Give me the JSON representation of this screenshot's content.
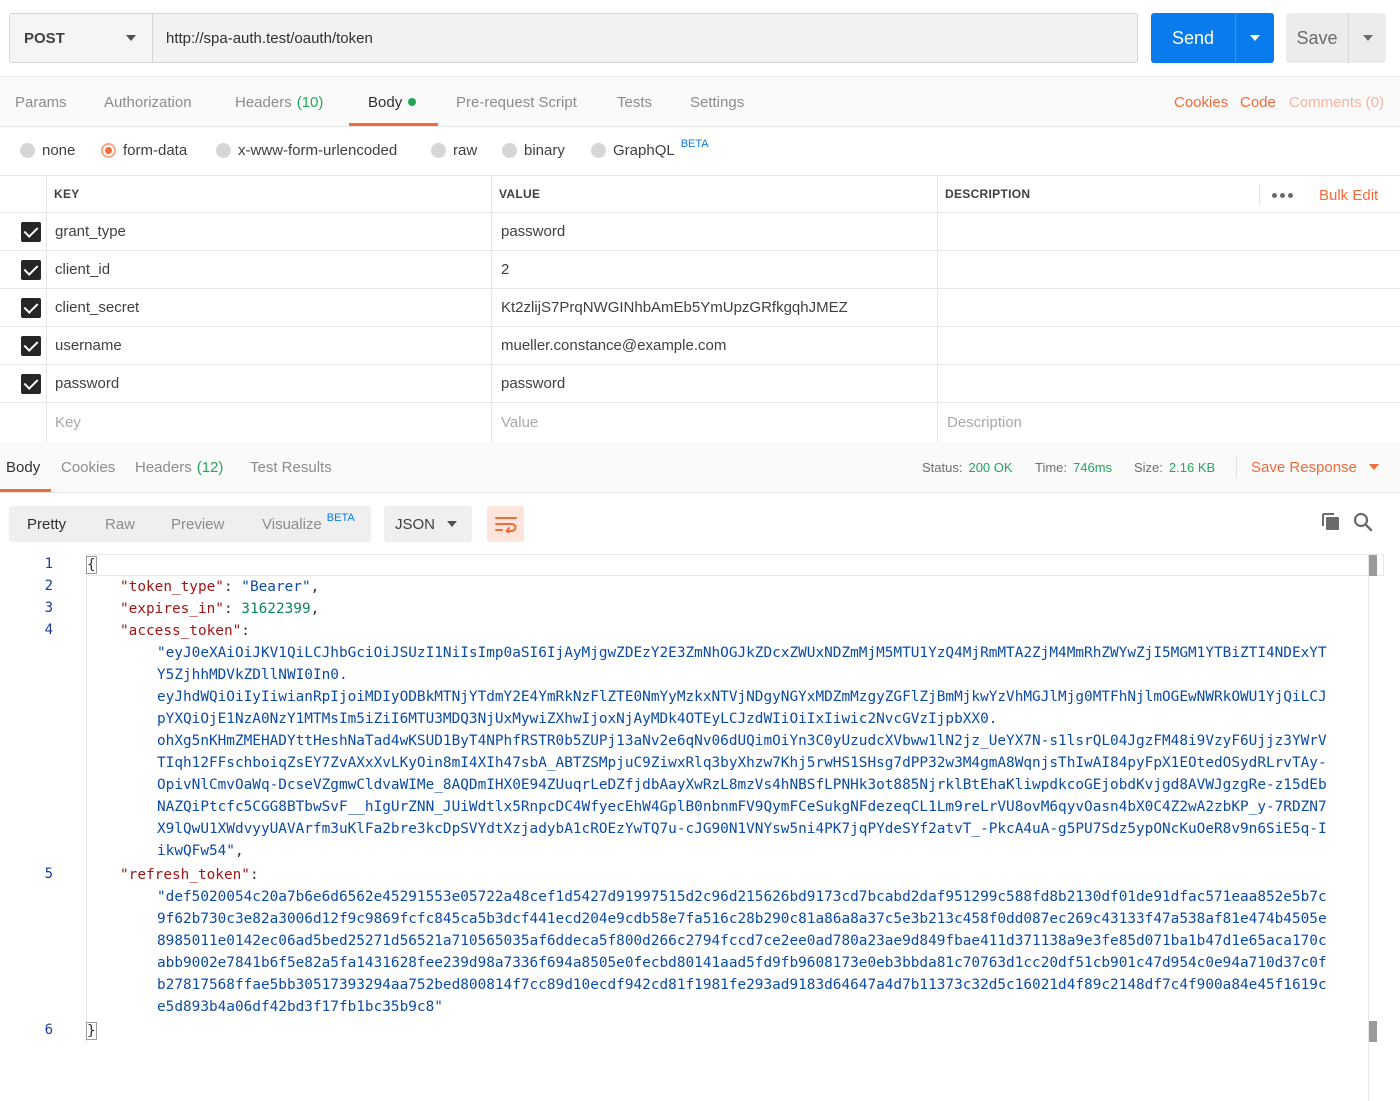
{
  "request": {
    "method": "POST",
    "url": "http://spa-auth.test/oauth/token",
    "send_label": "Send",
    "save_label": "Save"
  },
  "request_tabs": {
    "params": "Params",
    "authorization": "Authorization",
    "headers": "Headers",
    "headers_count": "(10)",
    "body": "Body",
    "pre_request": "Pre-request Script",
    "tests": "Tests",
    "settings": "Settings",
    "cookies": "Cookies",
    "code": "Code",
    "comments": "Comments (0)"
  },
  "body_types": {
    "none": "none",
    "form_data": "form-data",
    "urlencoded": "x-www-form-urlencoded",
    "raw": "raw",
    "binary": "binary",
    "graphql": "GraphQL",
    "beta": "BETA"
  },
  "params_table": {
    "headers": {
      "key": "KEY",
      "value": "VALUE",
      "description": "DESCRIPTION"
    },
    "bulk_edit": "Bulk Edit",
    "rows": [
      {
        "key": "grant_type",
        "value": "password"
      },
      {
        "key": "client_id",
        "value": "2"
      },
      {
        "key": "client_secret",
        "value": "Kt2zlijS7PrqNWGINhbAmEb5YmUpzGRfkgqhJMEZ"
      },
      {
        "key": "username",
        "value": "mueller.constance@example.com"
      },
      {
        "key": "password",
        "value": "password"
      }
    ],
    "placeholders": {
      "key": "Key",
      "value": "Value",
      "description": "Description"
    }
  },
  "response_tabs": {
    "body": "Body",
    "cookies": "Cookies",
    "headers": "Headers",
    "headers_count": "(12)",
    "test_results": "Test Results",
    "status_label": "Status:",
    "status_value": "200 OK",
    "time_label": "Time:",
    "time_value": "746ms",
    "size_label": "Size:",
    "size_value": "2.16 KB",
    "save_response": "Save Response"
  },
  "view": {
    "pretty": "Pretty",
    "raw": "Raw",
    "preview": "Preview",
    "visualize": "Visualize",
    "beta": "BETA",
    "format": "JSON"
  },
  "json_body": {
    "line_numbers": [
      "1",
      "2",
      "3",
      "4",
      "5",
      "6"
    ],
    "open_brace": "{",
    "close_brace": "}",
    "token_type_key": "\"token_type\"",
    "token_type_value": "\"Bearer\"",
    "expires_in_key": "\"expires_in\"",
    "expires_in_value": "31622399",
    "access_token_key": "\"access_token\"",
    "access_token_lines": [
      "\"eyJ0eXAiOiJKV1QiLCJhbGciOiJSUzI1NiIsImp0aSI6IjAyMjgwZDEzY2E3ZmNhOGJkZDcxZWUxNDZmMjM5MTU1YzQ4MjRmMTA2ZjM4MmRhZWYwZjI5MGM1YTBiZTI4NDExYT",
      "Y5ZjhhMDVkZDllNWI0In0.",
      "eyJhdWQiOiIyIiwianRpIjoiMDIyODBkMTNjYTdmY2E4YmRkNzFlZTE0NmYyMzkxNTVjNDgyNGYxMDZmMzgyZGFlZjBmMjkwYzVhMGJlMjg0MTFhNjlmOGEwNWRkOWU1YjQiLCJ",
      "pYXQiOjE1NzA0NzY1MTMsIm5iZiI6MTU3MDQ3NjUxMywiZXhwIjoxNjAyMDk4OTEyLCJzdWIiOiIxIiwic2NvcGVzIjpbXX0.",
      "ohXg5nKHmZMEHADYttHeshNaTad4wKSUD1ByT4NPhfRSTR0b5ZUPj13aNv2e6qNv06dUQimOiYn3C0yUzudcXVbww1lN2jz_UeYX7N-s1lsrQL04JgzFM48i9VzyF6Ujjz3YWrV",
      "TIqh12FFschboiqZsEY7ZvAXxXvLKyOin8mI4XIh47sbA_ABTZSMpjuC9ZiwxRlq3byXhzw7Khj5rwHS1SHsg7dPP32w3M4gmA8WqnjsThIwAI84pyFpX1EOtedOSydRLrvTAy-",
      "OpivNlCmvOaWq-DcseVZgmwCldvaWIMe_8AQDmIHX0E94ZUuqrLeDZfjdbAayXwRzL8mzVs4hNBSfLPNHk3ot885NjrklBtEhaKliwpdkcoGEjobdKvjgd8AVWJgzgRe-z15dEb",
      "NAZQiPtcfc5CGG8BTbwSvF__hIgUrZNN_JUiWdtlx5RnpcDC4WfyecEhW4GplB0nbnmFV9QymFCeSukgNFdezeqCL1Lm9reLrVU8ovM6qyvOasn4bX0C4Z2wA2zbKP_y-7RDZN7",
      "X9lQwU1XWdvyyUAVArfm3uKlFa2bre3kcDpSVYdtXzjadybA1cROEzYwTQ7u-cJG90N1VNYsw5ni4PK7jqPYdeSYf2atvT_-PkcA4uA-g5PU7Sdz5ypONcKuOeR8v9n6SiE5q-I",
      "ikwQFw54\""
    ],
    "refresh_token_key": "\"refresh_token\"",
    "refresh_token_lines": [
      "\"def5020054c20a7b6e6d6562e45291553e05722a48cef1d5427d91997515d2c96d215626bd9173cd7bcabd2daf951299c588fd8b2130df01de91dfac571eaa852e5b7c",
      "9f62b730c3e82a3006d12f9c9869fcfc845ca5b3dcf441ecd204e9cdb58e7fa516c28b290c81a86a8a37c5e3b213c458f0dd087ec269c43133f47a538af81e474b4505e",
      "8985011e0142ec06ad5bed25271d56521a710565035af6ddeca5f800d266c2794fccd7ce2ee0ad780a23ae9d849fbae411d371138a9e3fe85d071ba1b47d1e65aca170c",
      "abb9002e7841b6f5e82a5fa1431628fee239d98a7336f694a8505e0fecbd80141aad5fd9fb9608173e0eb3bbda81c70763d1cc20df51cb901c47d954c0e94a710d37c0f",
      "b27817568ffae5bb30517393294aa752bed800814f7cc89d10ecdf942cd81f1981fe293ad9183d64647a4d7b11373c32d5c16021d4f89c2148df7c4f900a84e45f1619c",
      "e5d893b4a06df42bd3f17fb1bc35b9c8\""
    ]
  },
  "icons": {
    "copy": "copy-icon",
    "search": "search-icon",
    "wrap": "wrap-lines-icon",
    "more": "more-horizontal-icon"
  },
  "colors": {
    "send_blue": "#097bed",
    "accent_orange": "#f26b3a",
    "status_green": "#26a65b"
  }
}
